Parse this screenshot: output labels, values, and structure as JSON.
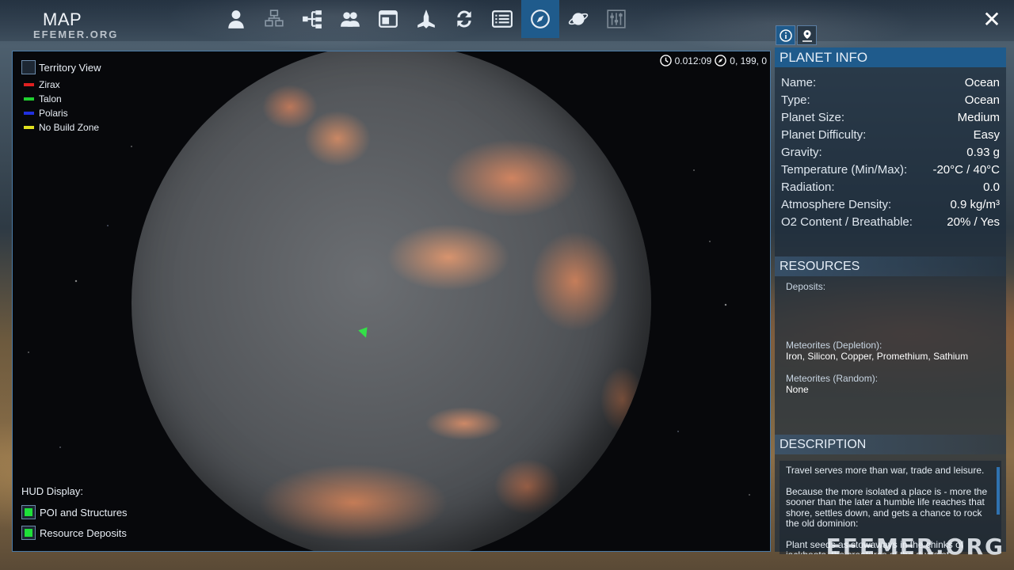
{
  "header": {
    "title": "MAP",
    "watermark": "EFEMER.ORG",
    "toolbar": [
      {
        "icon": "person-icon",
        "label": ""
      },
      {
        "icon": "structures-icon",
        "label": ""
      },
      {
        "icon": "tech-tree-icon",
        "label": ""
      },
      {
        "icon": "faction-icon",
        "label": ""
      },
      {
        "icon": "window-icon",
        "label": ""
      },
      {
        "icon": "ship-icon",
        "label": ""
      },
      {
        "icon": "trade-icon",
        "label": ""
      },
      {
        "icon": "list-icon",
        "label": ""
      },
      {
        "icon": "compass-icon",
        "label": "",
        "active": true
      },
      {
        "icon": "planet-icon",
        "label": ""
      },
      {
        "icon": "settings-icon",
        "label": ""
      }
    ],
    "close_symbol": "✕"
  },
  "map": {
    "legend": {
      "title": "Territory View",
      "items": [
        {
          "label": "Zirax",
          "color": "#e02020"
        },
        {
          "label": "Talon",
          "color": "#20d030"
        },
        {
          "label": "Polaris",
          "color": "#2030e0"
        },
        {
          "label": "No Build Zone",
          "color": "#e0e020"
        }
      ]
    },
    "time": "0.012:09",
    "coords": "0, 199, 0",
    "hud": {
      "title": "HUD Display:",
      "items": [
        {
          "label": "POI and Structures",
          "checked": true
        },
        {
          "label": "Resource Deposits",
          "checked": true
        }
      ]
    }
  },
  "planet_info": {
    "header": "PLANET INFO",
    "rows": [
      {
        "key": "Name:",
        "value": "Ocean"
      },
      {
        "key": "Type:",
        "value": "Ocean"
      },
      {
        "key": "Planet Size:",
        "value": "Medium"
      },
      {
        "key": "Planet Difficulty:",
        "value": "Easy"
      },
      {
        "key": "Gravity:",
        "value": "0.93 g"
      },
      {
        "key": "Temperature (Min/Max):",
        "value": "-20°C / 40°C"
      },
      {
        "key": "Radiation:",
        "value": "0.0"
      },
      {
        "key": "Atmosphere Density:",
        "value": "0.9 kg/m³"
      },
      {
        "key": "O2 Content / Breathable:",
        "value": "20% / Yes"
      }
    ]
  },
  "resources": {
    "header": "RESOURCES",
    "deposits_label": "Deposits:",
    "meteorites_depletion_label": "Meteorites (Depletion):",
    "meteorites_depletion_value": "Iron, Silicon, Copper, Promethium, Sathium",
    "meteorites_random_label": "Meteorites (Random):",
    "meteorites_random_value": "None"
  },
  "description": {
    "header": "DESCRIPTION",
    "paragraphs": [
      "Travel serves more than war, trade and leisure.",
      "Because the more isolated a place is -  more the sooner than the later a humble life reaches that shore, settles down, and gets a chance to rock the old dominion:",
      "Plant seeds as stowaways in the chinks of jackboots, the creatures of the ducts of"
    ]
  },
  "watermark_bottom": "EFEMER.ORG"
}
